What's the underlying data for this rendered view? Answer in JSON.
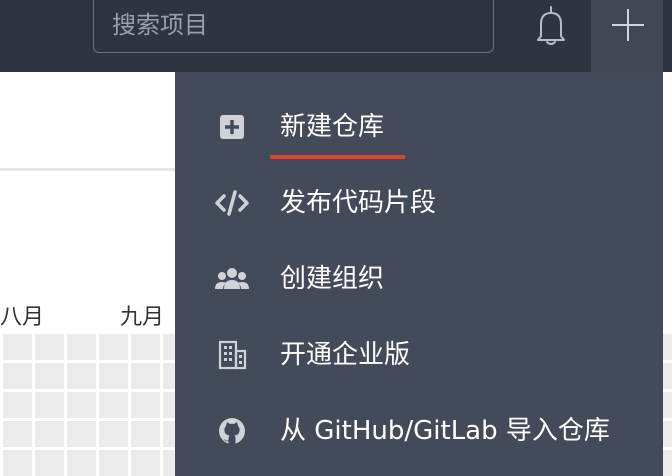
{
  "header": {
    "search_placeholder": "搜索项目",
    "notifications_icon": "bell-icon",
    "create_icon": "plus-icon"
  },
  "calendar": {
    "months": [
      "八月",
      "九月"
    ]
  },
  "menu": {
    "items": [
      {
        "label": "新建仓库",
        "icon": "plus-square-icon"
      },
      {
        "label": "发布代码片段",
        "icon": "code-icon"
      },
      {
        "label": "创建组织",
        "icon": "users-icon"
      },
      {
        "label": "开通企业版",
        "icon": "building-icon"
      },
      {
        "label": "从 GitHub/GitLab 导入仓库",
        "icon": "github-icon"
      }
    ],
    "active_index": 0
  },
  "colors": {
    "topbar": "#2e3440",
    "dropdown": "#434a5a",
    "accent": "#e0462a"
  }
}
